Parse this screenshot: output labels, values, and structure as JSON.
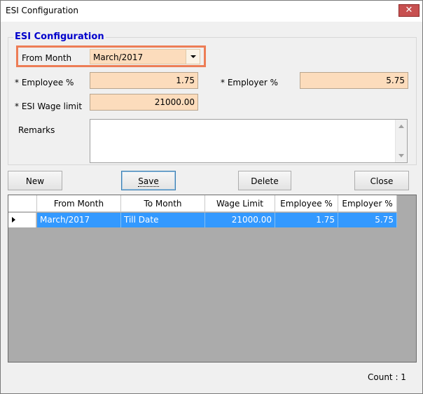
{
  "window": {
    "title": "ESI Configuration",
    "close_glyph": "✕"
  },
  "group": {
    "title": "ESI Configuration"
  },
  "form": {
    "from_month_label": "From Month",
    "from_month_value": "March/2017",
    "employee_pct_label": "* Employee %",
    "employee_pct_value": "1.75",
    "employer_pct_label": "* Employer %",
    "employer_pct_value": "5.75",
    "wage_limit_label": "* ESI Wage limit",
    "wage_limit_value": "21000.00",
    "remarks_label": "Remarks",
    "remarks_value": ""
  },
  "buttons": {
    "new": "New",
    "save": "Save",
    "delete": "Delete",
    "close": "Close"
  },
  "grid": {
    "columns": [
      "From Month",
      "To Month",
      "Wage Limit",
      "Employee %",
      "Employer %"
    ],
    "rows": [
      [
        "March/2017",
        "Till Date",
        "21000.00",
        "1.75",
        "5.75"
      ]
    ]
  },
  "footer": {
    "count": "Count : 1"
  },
  "colors": {
    "field_bg": "#fcdcbc",
    "highlight_border": "#ed7d56",
    "group_title": "#0000cc",
    "selected_row": "#3399ff",
    "grid_bg": "#ababab"
  },
  "icons": {
    "row_indicator": "triangle-right-icon",
    "combo": "chevron-down-icon",
    "close": "close-icon"
  }
}
